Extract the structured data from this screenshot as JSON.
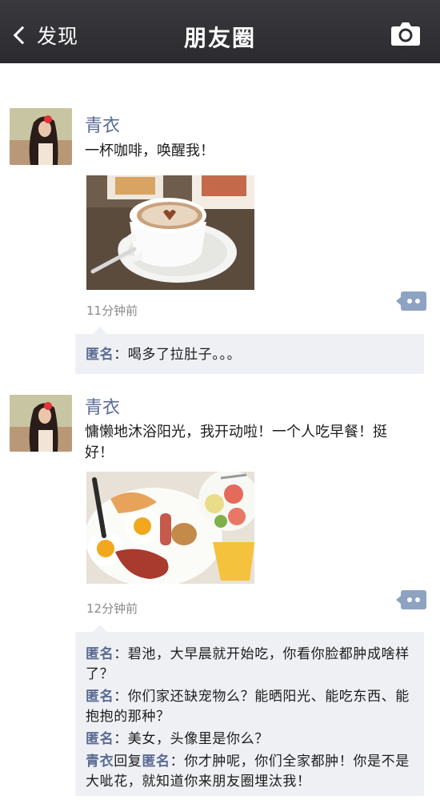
{
  "topbar": {
    "back_label": "发现",
    "title": "朋友圈"
  },
  "posts": [
    {
      "author": "青衣",
      "text": "一杯咖啡，唤醒我！",
      "time": "11分钟前",
      "comments": [
        {
          "name": "匿名",
          "text": "：喝多了拉肚子。。。"
        }
      ]
    },
    {
      "author": "青衣",
      "text": "慵懒地沐浴阳光，我开动啦！一个人吃早餐！挺好！",
      "time": "12分钟前",
      "comments": [
        {
          "name": "匿名",
          "text": "：碧池，大早晨就开始吃，你看你脸都肿成啥样了？"
        },
        {
          "name": "匿名",
          "text": "：你们家还缺宠物么？能晒阳光、能吃东西、能抱抱的那种？"
        },
        {
          "name": "匿名",
          "text": "：美女，头像里是你么？"
        },
        {
          "name": "青衣",
          "reply_word": "回复",
          "reply_to": "匿名",
          "text": "：你才肿呢，你们全家都肿！你是不是大呲花，就知道你来朋友圈埋汰我！"
        }
      ]
    }
  ]
}
